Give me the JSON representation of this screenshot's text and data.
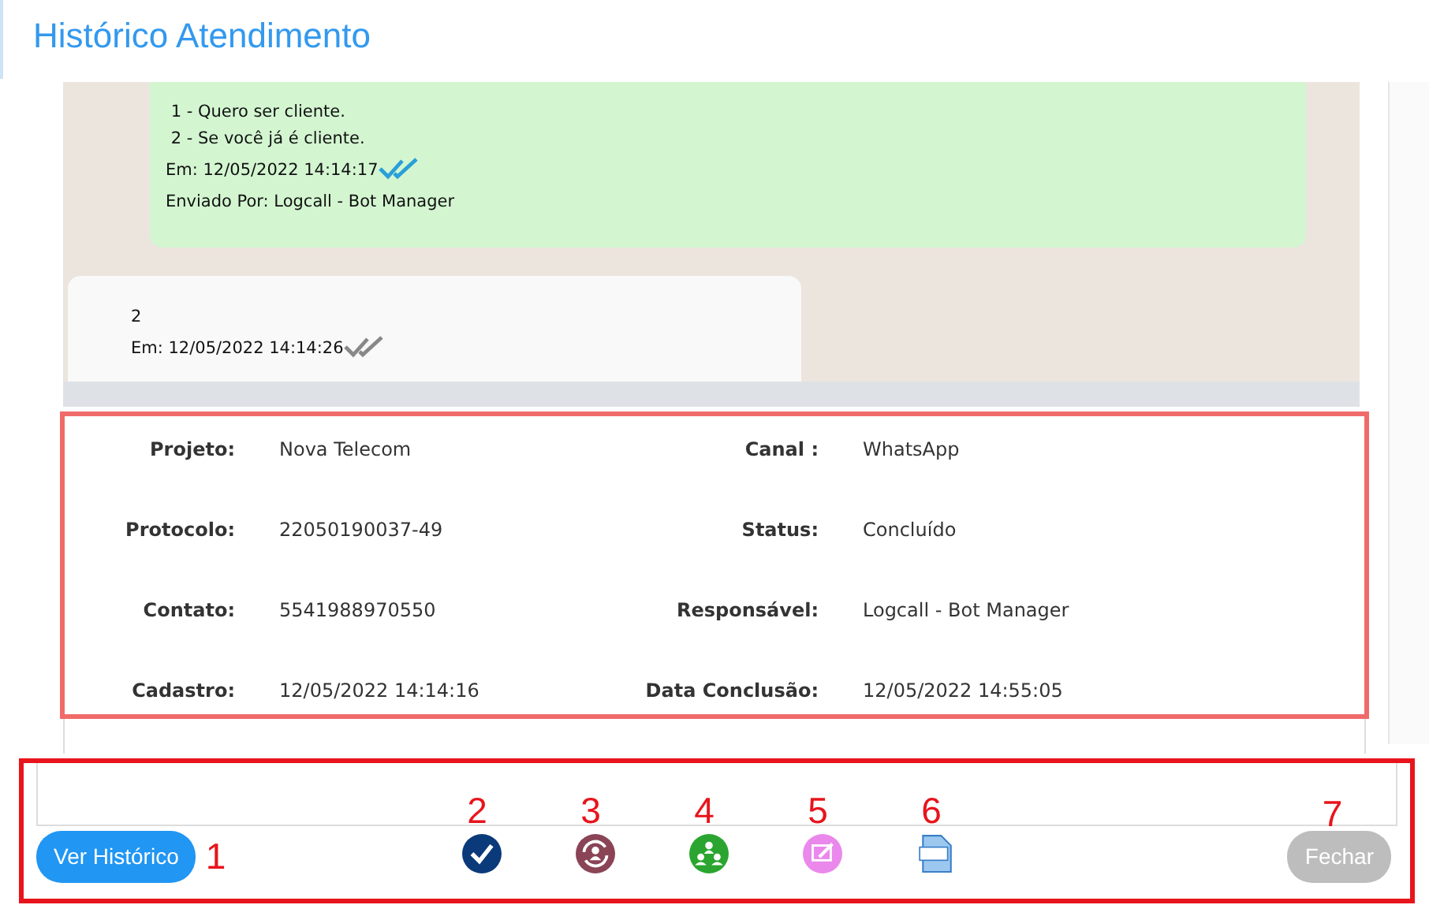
{
  "title": "Histórico Atendimento",
  "messages": [
    {
      "kind": "sent",
      "lines": [
        " 1 - Quero ser cliente.",
        " 2 - Se você já é cliente."
      ],
      "timestamp": "Em: 12/05/2022 14:14:17",
      "read": true,
      "sender": "Enviado Por: Logcall - Bot Manager"
    },
    {
      "kind": "received",
      "lines": [
        "2"
      ],
      "timestamp": "Em: 12/05/2022 14:14:26",
      "read": false
    }
  ],
  "details": {
    "highlighted": true,
    "fields": [
      {
        "label": "Projeto:",
        "value": "Nova Telecom"
      },
      {
        "label": "Canal :",
        "value": "WhatsApp"
      },
      {
        "label": "Protocolo:",
        "value": "22050190037-49"
      },
      {
        "label": "Status:",
        "value": "Concluído"
      },
      {
        "label": "Contato:",
        "value": "5541988970550"
      },
      {
        "label": "Responsável:",
        "value": "Logcall - Bot Manager"
      },
      {
        "label": "Cadastro:",
        "value": "12/05/2022 14:14:16"
      },
      {
        "label": "Data Conclusão:",
        "value": "12/05/2022 14:55:05"
      }
    ]
  },
  "footer": {
    "highlighted": true,
    "items": [
      {
        "kind": "button",
        "label": "Ver Histórico",
        "marker": "1",
        "disabled": false
      },
      {
        "kind": "check",
        "marker": "2"
      },
      {
        "kind": "transfer",
        "marker": "3"
      },
      {
        "kind": "users",
        "marker": "4"
      },
      {
        "kind": "edit",
        "marker": "5"
      },
      {
        "kind": "pdf",
        "marker": "6"
      },
      {
        "kind": "button",
        "label": "Fechar",
        "marker": "7",
        "disabled": true
      }
    ]
  }
}
